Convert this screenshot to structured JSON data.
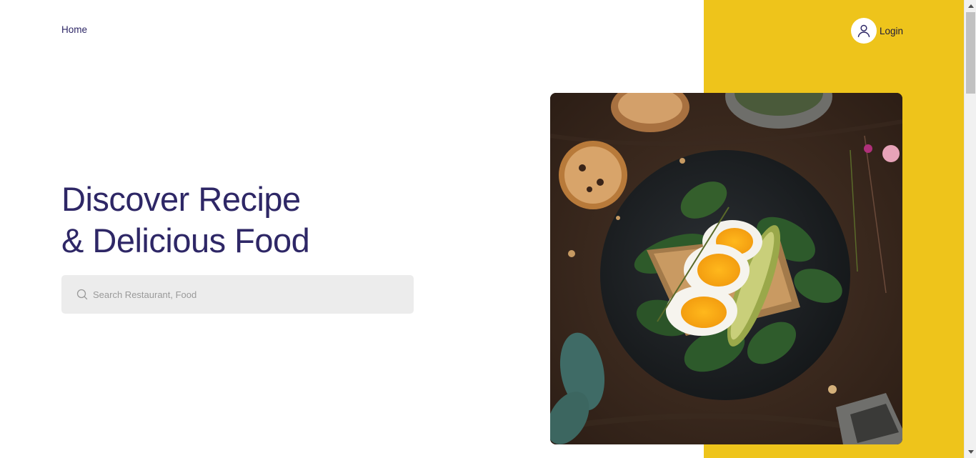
{
  "nav": {
    "home_label": "Home"
  },
  "header": {
    "login_label": "Login",
    "login_icon": "user-icon"
  },
  "hero": {
    "title_line1": "Discover Recipe",
    "title_line2": "& Delicious Food"
  },
  "search": {
    "placeholder": "Search Restaurant, Food",
    "value": "",
    "icon": "search-icon"
  },
  "image": {
    "alt": "food-photo"
  },
  "colors": {
    "accent_yellow": "#eec41b",
    "title_navy": "#2e2766",
    "search_bg": "#ececec"
  }
}
